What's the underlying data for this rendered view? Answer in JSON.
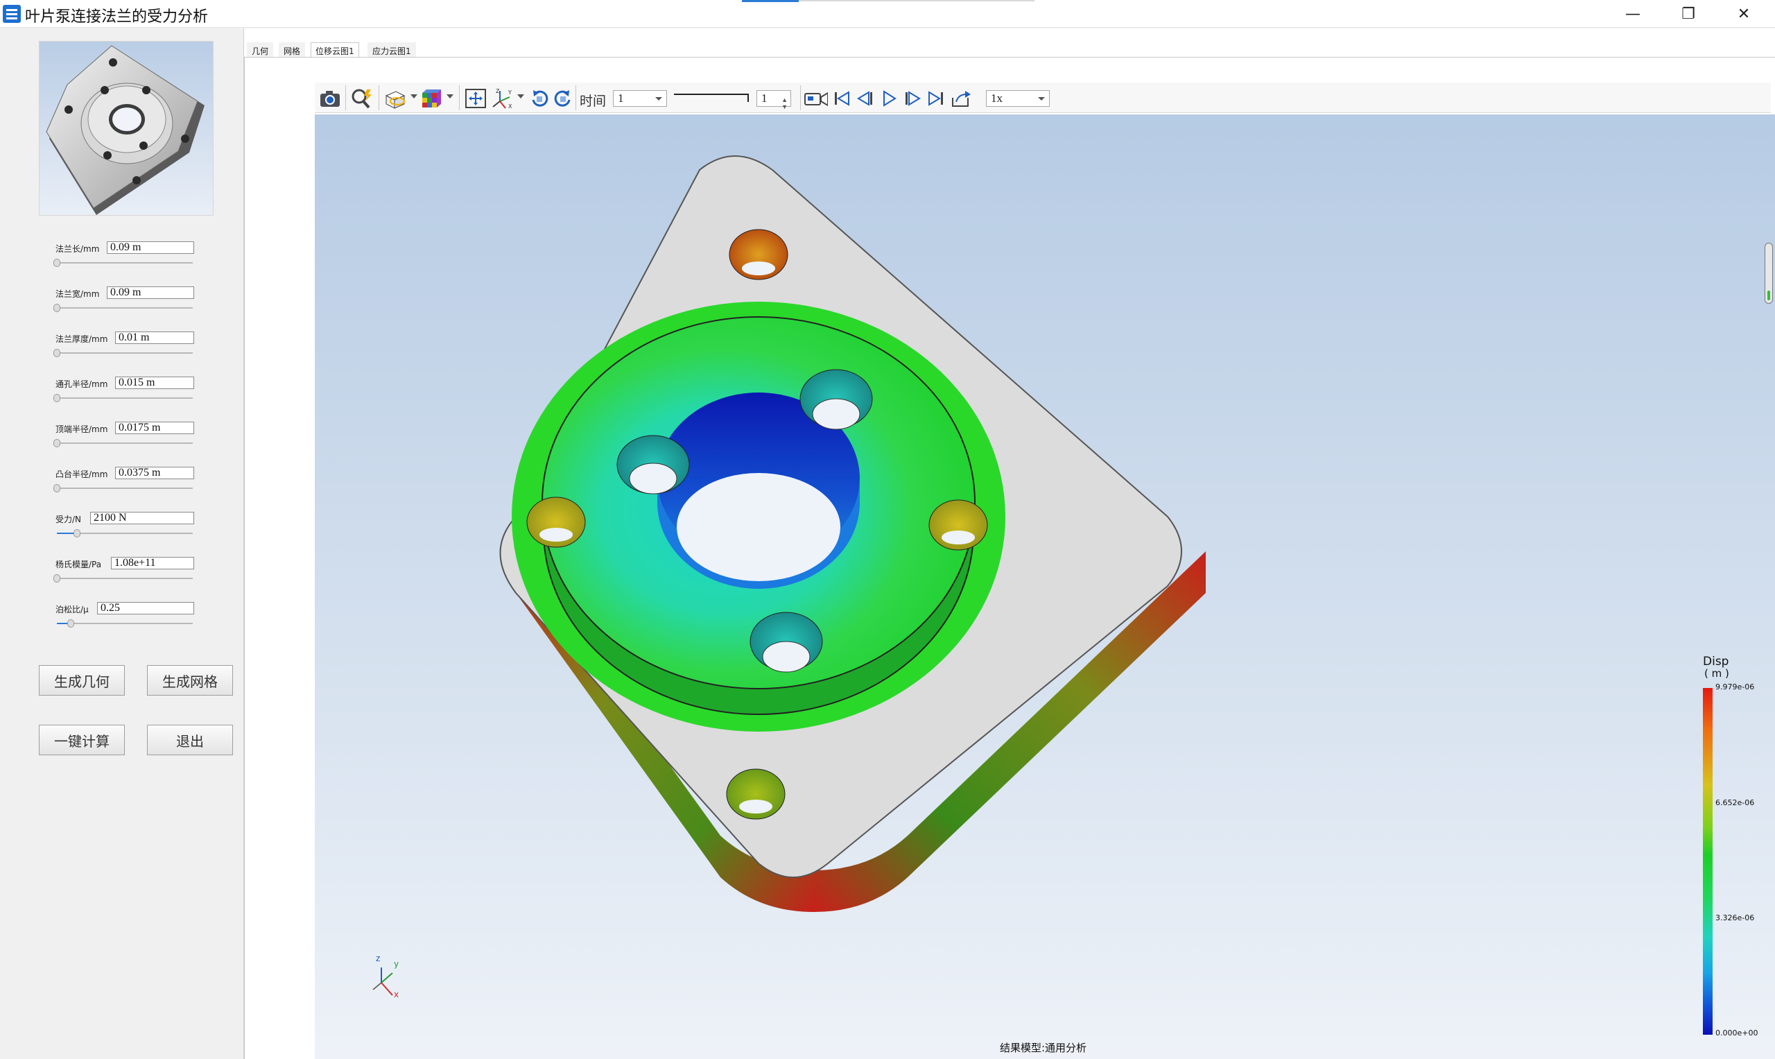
{
  "window": {
    "title": "叶片泵连接法兰的受力分析",
    "controls": {
      "minimize": "—",
      "maximize": "❐",
      "close": "✕"
    }
  },
  "params": [
    {
      "label": "法兰长/mm",
      "value": "0.09 m",
      "fill": 0.0
    },
    {
      "label": "法兰宽/mm",
      "value": "0.09 m",
      "fill": 0.0
    },
    {
      "label": "法兰厚度/mm",
      "value": "0.01 m",
      "fill": 0.0
    },
    {
      "label": "通孔半径/mm",
      "value": "0.015 m",
      "fill": 0.0
    },
    {
      "label": "顶端半径/mm",
      "value": "0.0175 m",
      "fill": 0.0
    },
    {
      "label": "凸台半径/mm",
      "value": "0.0375 m",
      "fill": 0.0
    },
    {
      "label": "受力/N",
      "value": "2100 N",
      "fill": 0.15
    },
    {
      "label": "杨氏模量/Pa",
      "value": "1.08e+11",
      "fill": 0.0
    },
    {
      "label": "泊松比/μ",
      "value": "0.25",
      "fill": 0.1
    }
  ],
  "buttons": {
    "gen_geometry": "生成几何",
    "gen_mesh": "生成网格",
    "compute": "一键计算",
    "exit": "退出"
  },
  "tabs": [
    {
      "label": "几何",
      "active": false
    },
    {
      "label": "网格",
      "active": false
    },
    {
      "label": "位移云图1",
      "active": true
    },
    {
      "label": "应力云图1",
      "active": false
    }
  ],
  "toolbar": {
    "time_label": "时间",
    "time_value": "1",
    "frame_value": "1",
    "speed_value": "1x"
  },
  "legend": {
    "title": "Disp",
    "unit": "( m )",
    "ticks": [
      "9.979e-06",
      "6.652e-06",
      "3.326e-06",
      "0.000e+00"
    ]
  },
  "axes_triad": {
    "x": "x",
    "y": "y",
    "z": "z"
  },
  "status": "结果模型:通用分析"
}
